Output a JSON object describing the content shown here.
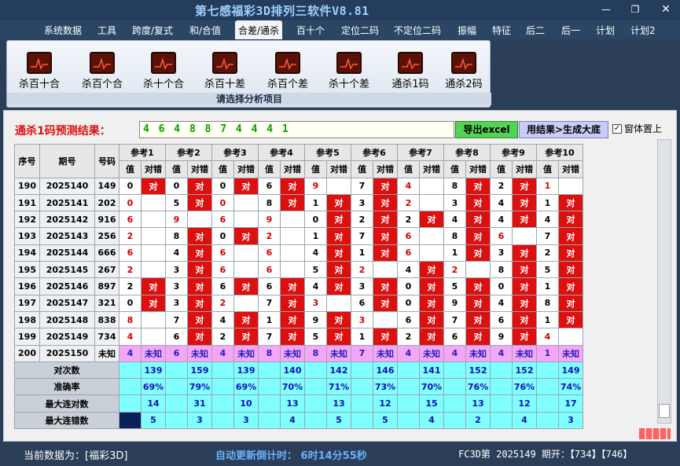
{
  "title": "第七感福彩3D排列三软件V8.81",
  "menu": [
    "系统数据",
    "工具",
    "跨度/复式",
    "和/合值",
    "合差/通杀",
    "百十个",
    "定位二码",
    "不定位二码",
    "振幅",
    "特征",
    "后二",
    "后一",
    "计划",
    "计划2"
  ],
  "menu_active": 4,
  "ribbon": {
    "buttons": [
      "杀百十合",
      "杀百个合",
      "杀十个合",
      "杀百十差",
      "杀百个差",
      "杀十个差",
      "通杀1码",
      "通杀2码"
    ],
    "group_label": "请选择分析项目"
  },
  "result": {
    "label": "通杀1码预测结果：",
    "value": "4 6 4 8 8 7 4 4 4 1",
    "export_btn": "导出excel",
    "generate_btn": "用结果>生成大底",
    "topmost_label": "窗体置上"
  },
  "grid": {
    "col_headers": [
      "序号",
      "期号",
      "号码"
    ],
    "refs": [
      "参考1",
      "参考2",
      "参考3",
      "参考4",
      "参考5",
      "参考6",
      "参考7",
      "参考8",
      "参考9",
      "参考10"
    ],
    "sub_headers": [
      "值",
      "对错"
    ],
    "hit_text": "对",
    "rows": [
      {
        "seq": "190",
        "issue": "2025140",
        "num": "149",
        "vals": [
          "0",
          "0",
          "0",
          "6",
          "9",
          "7",
          "4",
          "8",
          "2",
          "1"
        ],
        "red": [
          false,
          false,
          false,
          false,
          true,
          false,
          true,
          false,
          false,
          true
        ],
        "hits": [
          true,
          true,
          true,
          true,
          false,
          true,
          false,
          true,
          true,
          false
        ]
      },
      {
        "seq": "191",
        "issue": "2025141",
        "num": "202",
        "vals": [
          "0",
          "5",
          "0",
          "8",
          "1",
          "3",
          "2",
          "3",
          "4",
          "1"
        ],
        "red": [
          true,
          false,
          true,
          false,
          false,
          false,
          true,
          false,
          false,
          false
        ],
        "hits": [
          false,
          true,
          false,
          true,
          true,
          true,
          false,
          true,
          true,
          true
        ]
      },
      {
        "seq": "192",
        "issue": "2025142",
        "num": "916",
        "vals": [
          "6",
          "9",
          "6",
          "9",
          "0",
          "2",
          "2",
          "4",
          "4",
          "4"
        ],
        "red": [
          true,
          true,
          true,
          true,
          false,
          false,
          false,
          false,
          false,
          false
        ],
        "hits": [
          false,
          false,
          false,
          false,
          true,
          true,
          true,
          true,
          true,
          true
        ]
      },
      {
        "seq": "193",
        "issue": "2025143",
        "num": "256",
        "vals": [
          "2",
          "8",
          "0",
          "2",
          "1",
          "7",
          "6",
          "8",
          "6",
          "7"
        ],
        "red": [
          true,
          false,
          false,
          true,
          false,
          false,
          true,
          false,
          true,
          false
        ],
        "hits": [
          false,
          true,
          true,
          false,
          true,
          true,
          false,
          true,
          false,
          true
        ]
      },
      {
        "seq": "194",
        "issue": "2025144",
        "num": "666",
        "vals": [
          "6",
          "4",
          "6",
          "6",
          "4",
          "1",
          "6",
          "1",
          "3",
          "2"
        ],
        "red": [
          true,
          false,
          true,
          true,
          false,
          false,
          true,
          false,
          false,
          false
        ],
        "hits": [
          false,
          true,
          false,
          false,
          true,
          true,
          false,
          true,
          true,
          true
        ]
      },
      {
        "seq": "195",
        "issue": "2025145",
        "num": "267",
        "vals": [
          "2",
          "3",
          "6",
          "6",
          "5",
          "2",
          "4",
          "2",
          "8",
          "5"
        ],
        "red": [
          true,
          false,
          true,
          true,
          false,
          true,
          false,
          true,
          false,
          false
        ],
        "hits": [
          false,
          true,
          false,
          false,
          true,
          false,
          true,
          false,
          true,
          true
        ]
      },
      {
        "seq": "196",
        "issue": "2025146",
        "num": "897",
        "vals": [
          "2",
          "3",
          "6",
          "6",
          "4",
          "3",
          "0",
          "5",
          "0",
          "1"
        ],
        "red": [
          false,
          false,
          false,
          false,
          false,
          false,
          false,
          false,
          false,
          false
        ],
        "hits": [
          true,
          true,
          true,
          true,
          true,
          true,
          true,
          true,
          true,
          true
        ]
      },
      {
        "seq": "197",
        "issue": "2025147",
        "num": "321",
        "vals": [
          "0",
          "3",
          "2",
          "7",
          "3",
          "6",
          "0",
          "9",
          "4",
          "8"
        ],
        "red": [
          false,
          false,
          true,
          false,
          true,
          false,
          false,
          false,
          false,
          false
        ],
        "hits": [
          true,
          true,
          false,
          true,
          false,
          true,
          true,
          true,
          true,
          true
        ]
      },
      {
        "seq": "198",
        "issue": "2025148",
        "num": "838",
        "vals": [
          "8",
          "7",
          "4",
          "1",
          "9",
          "3",
          "6",
          "7",
          "6",
          "1"
        ],
        "red": [
          true,
          false,
          false,
          false,
          false,
          true,
          false,
          false,
          false,
          false
        ],
        "hits": [
          false,
          true,
          true,
          true,
          true,
          false,
          true,
          true,
          true,
          true
        ]
      },
      {
        "seq": "199",
        "issue": "2025149",
        "num": "734",
        "vals": [
          "4",
          "6",
          "2",
          "7",
          "5",
          "1",
          "2",
          "6",
          "9",
          "4"
        ],
        "red": [
          true,
          false,
          false,
          false,
          false,
          false,
          false,
          false,
          false,
          true
        ],
        "hits": [
          false,
          true,
          true,
          true,
          true,
          true,
          true,
          true,
          true,
          false
        ]
      }
    ],
    "unknown_row": {
      "seq": "200",
      "issue": "2025150",
      "num": "未知",
      "vals": [
        "4",
        "6",
        "4",
        "8",
        "8",
        "7",
        "4",
        "4",
        "4",
        "1"
      ],
      "label": "未知"
    },
    "stats": [
      {
        "label": "对次数",
        "values": [
          "139",
          "159",
          "139",
          "140",
          "142",
          "146",
          "141",
          "152",
          "152",
          "149"
        ]
      },
      {
        "label": "准确率",
        "values": [
          "69%",
          "79%",
          "69%",
          "70%",
          "71%",
          "73%",
          "70%",
          "76%",
          "76%",
          "74%"
        ]
      },
      {
        "label": "最大连对数",
        "values": [
          "14",
          "31",
          "10",
          "13",
          "13",
          "12",
          "15",
          "13",
          "12",
          "17"
        ]
      },
      {
        "label": "最大连错数",
        "values": [
          "5",
          "3",
          "3",
          "4",
          "5",
          "5",
          "4",
          "2",
          "4",
          "3"
        ]
      }
    ]
  },
  "status": {
    "current_data": "当前数据为：[福彩3D]",
    "countdown": "自动更新倒计时： 6时14分55秒",
    "period": "FC3D第 2025149 期开：【734】【746】"
  }
}
